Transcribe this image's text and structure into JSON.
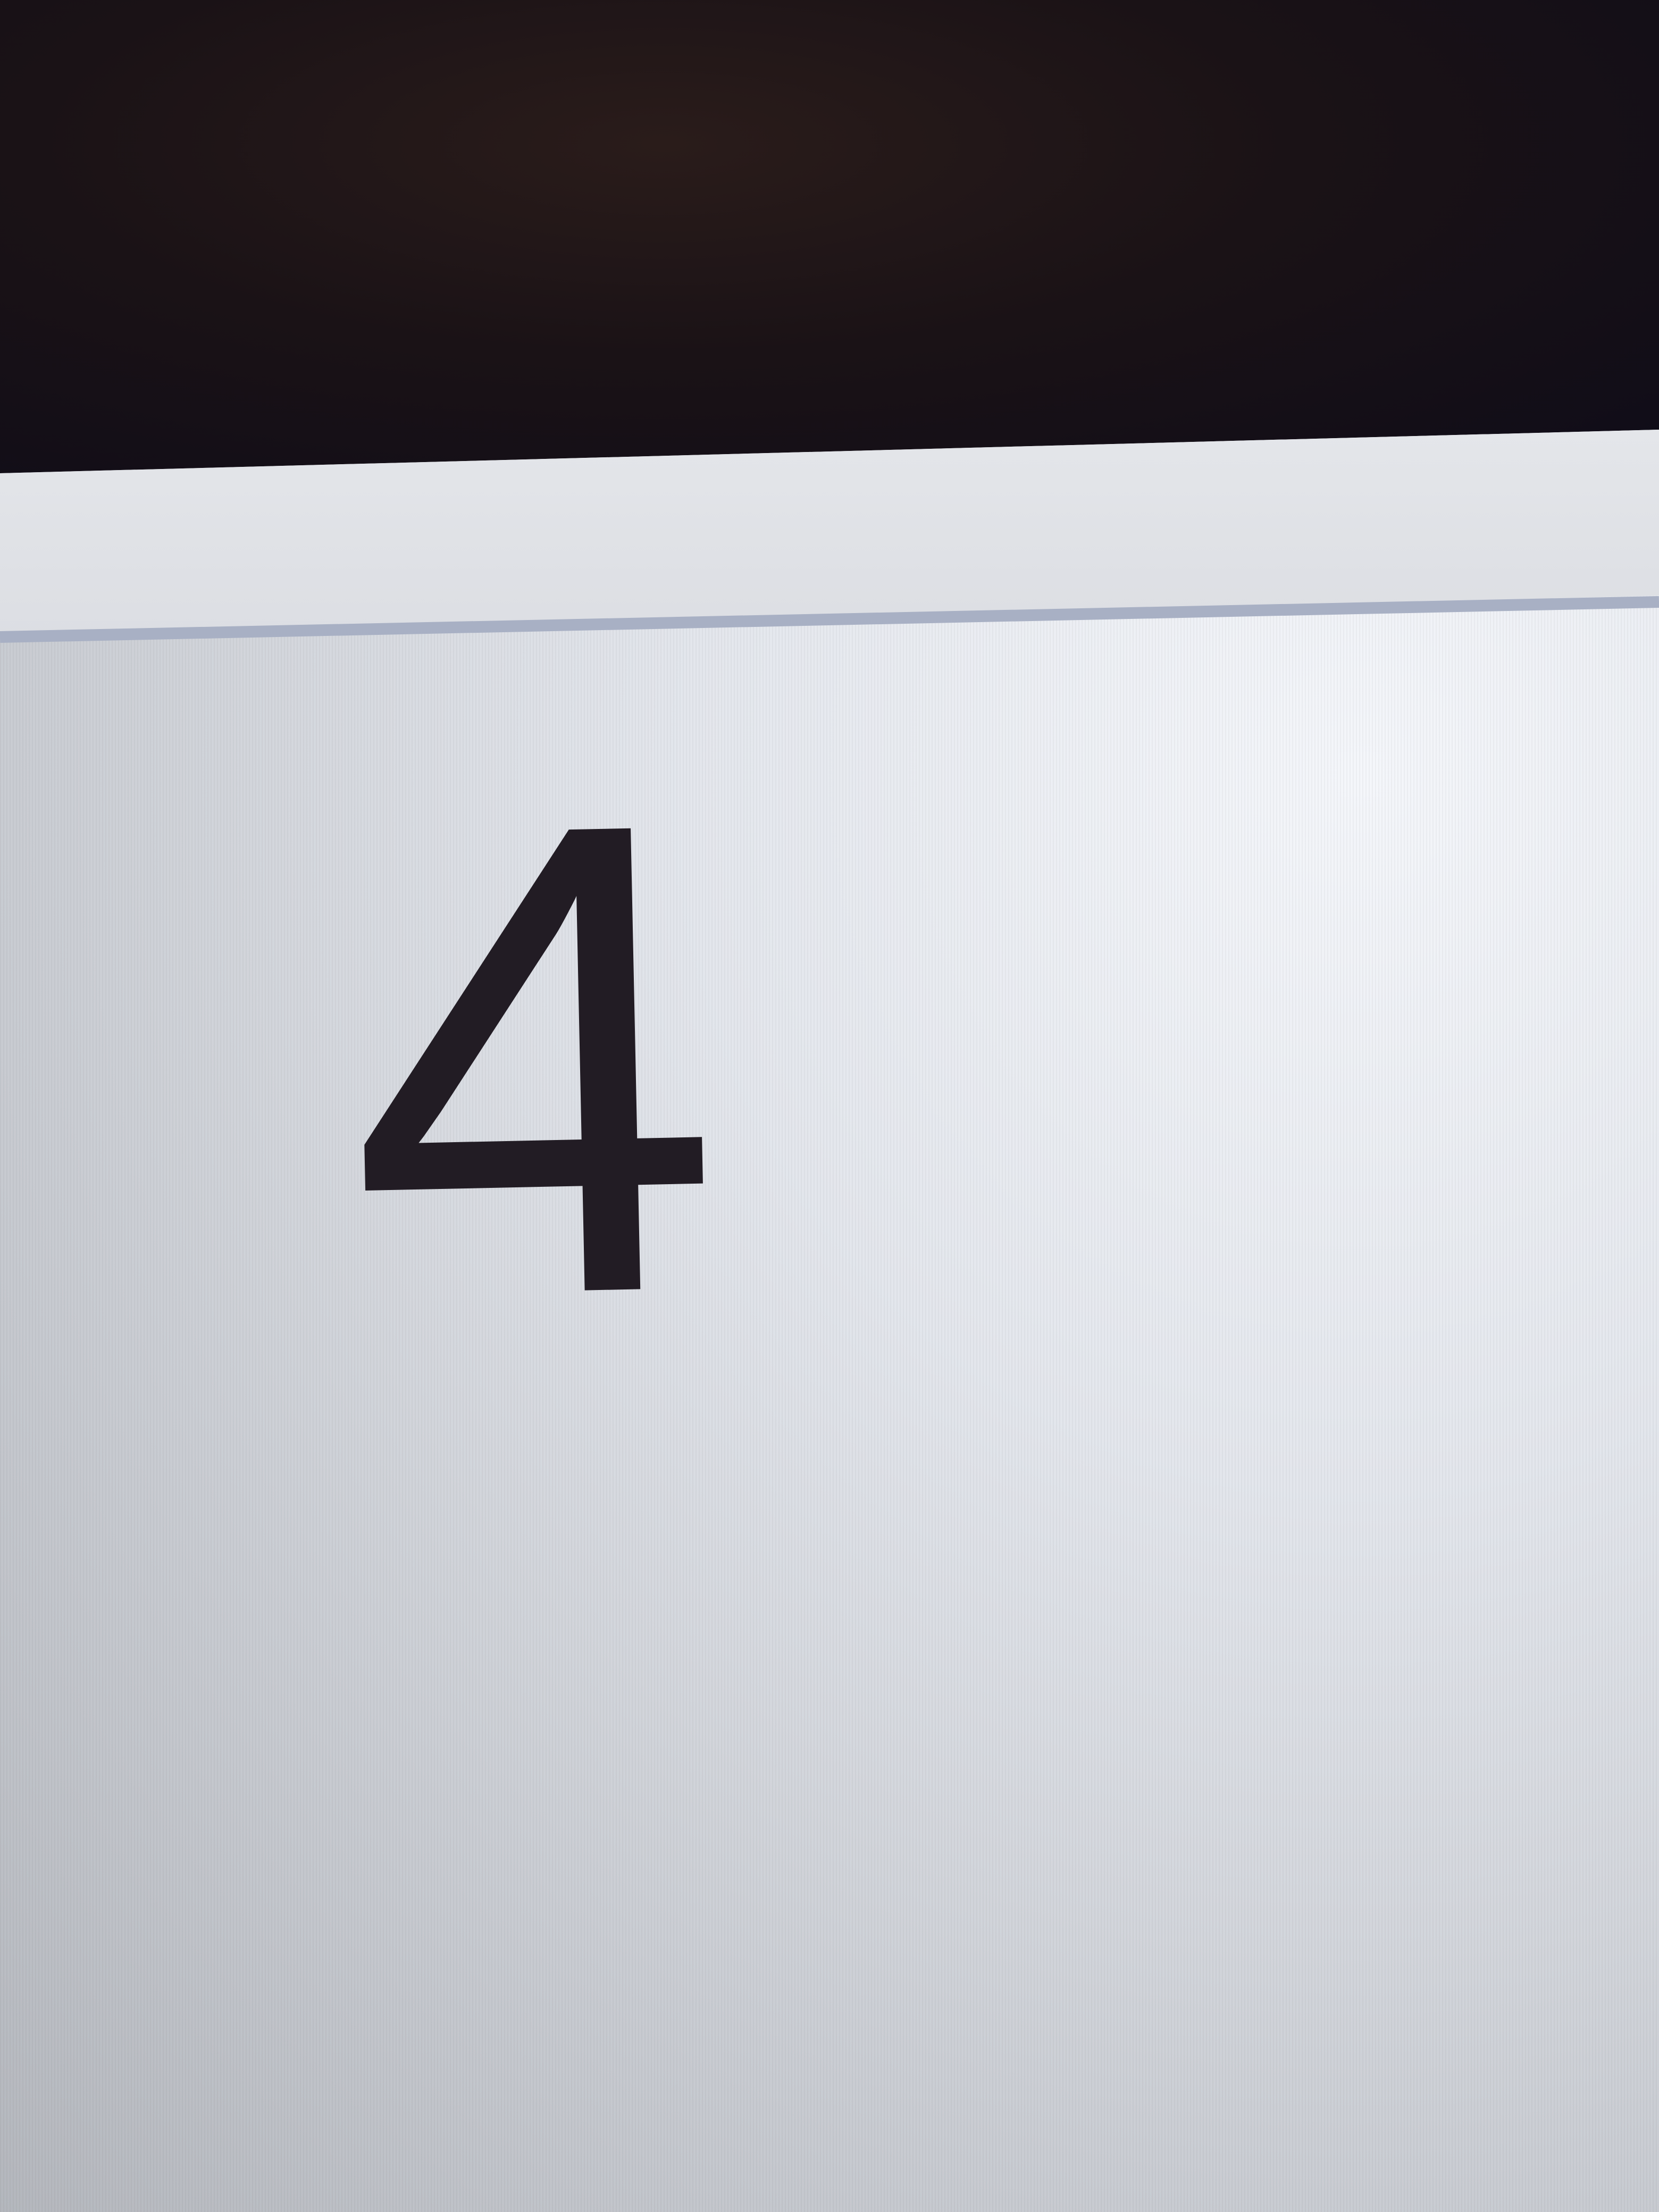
{
  "main": {
    "value": "4"
  }
}
